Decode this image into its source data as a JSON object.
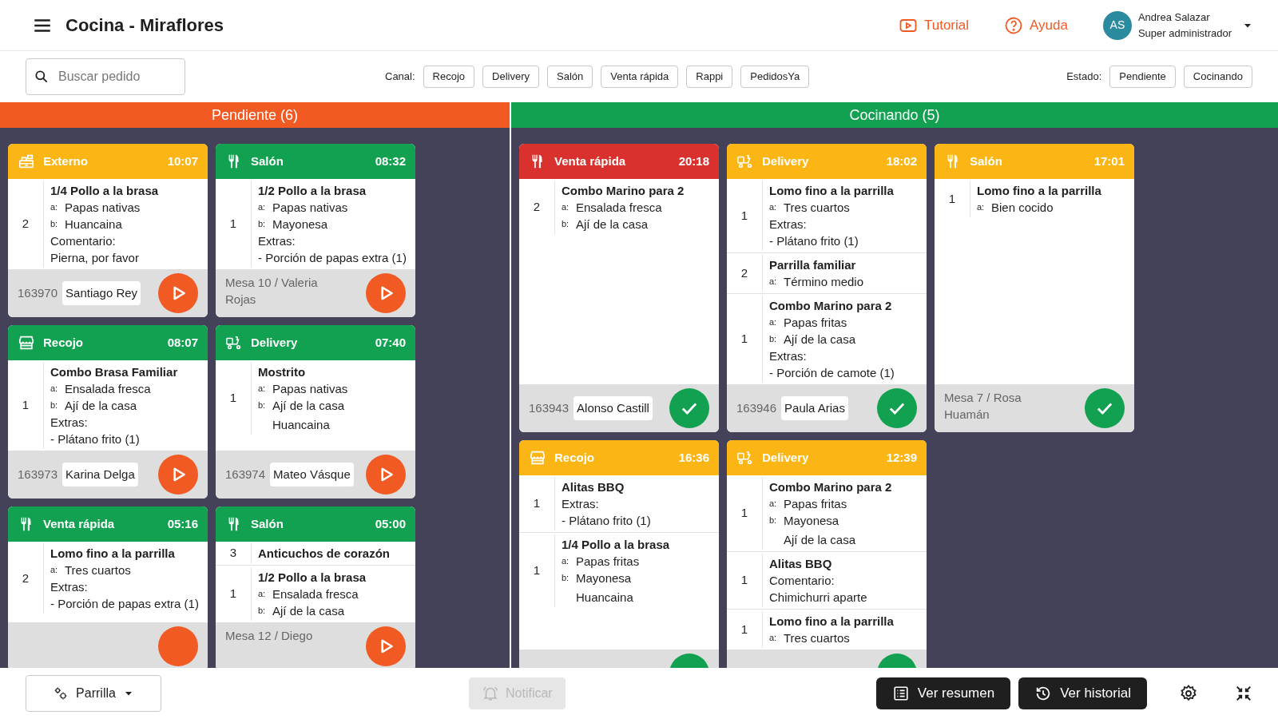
{
  "header": {
    "title": "Cocina - Miraflores",
    "links": [
      {
        "kind": "video",
        "label": "Tutorial"
      },
      {
        "kind": "help",
        "label": "Ayuda"
      }
    ],
    "user": {
      "initials": "AS",
      "name": "Andrea Salazar",
      "role": "Super administrador"
    }
  },
  "filters": {
    "search": {
      "placeholder": "Buscar pedido"
    },
    "channel": {
      "label": "Canal:",
      "options": [
        "Recojo",
        "Delivery",
        "Salón",
        "Venta rápida",
        "Rappi",
        "PedidosYa"
      ]
    },
    "state": {
      "label": "Estado:",
      "options": [
        "Pendiente",
        "Cocinando"
      ]
    }
  },
  "columns": [
    {
      "title": "Pendiente (6)",
      "color": "#f15a22",
      "kind": "pending",
      "cards": [
        {
          "kind": "register",
          "channel": "Externo",
          "time": "10:07",
          "color": "#fbb615",
          "items": [
            {
              "qty": "2",
              "name": "1/4 Pollo a la brasa",
              "lines": [
                {
                  "kind": "option",
                  "label": "a:",
                  "text": "Papas nativas"
                },
                {
                  "kind": "option",
                  "label": "b:",
                  "text": "Huancaina"
                },
                {
                  "kind": "note",
                  "text": "Comentario:"
                },
                {
                  "kind": "note",
                  "text": "Pierna, por favor"
                }
              ]
            }
          ],
          "footer": {
            "order": "163970",
            "customer": "Santiago Rey"
          }
        },
        {
          "kind": "cutlery",
          "channel": "Salón",
          "time": "08:32",
          "color": "#12a150",
          "items": [
            {
              "qty": "1",
              "name": "1/2 Pollo a la brasa",
              "lines": [
                {
                  "kind": "option",
                  "label": "a:",
                  "text": "Papas nativas"
                },
                {
                  "kind": "option",
                  "label": "b:",
                  "text": "Mayonesa"
                },
                {
                  "kind": "note",
                  "text": "Extras:"
                },
                {
                  "kind": "note",
                  "text": "- Porción de papas extra (1)"
                }
              ]
            }
          ],
          "footer": {
            "table": "Mesa 10 / Valeria Rojas"
          }
        },
        {
          "kind": "store",
          "channel": "Recojo",
          "time": "08:07",
          "color": "#12a150",
          "items": [
            {
              "qty": "1",
              "name": "Combo Brasa Familiar",
              "lines": [
                {
                  "kind": "option",
                  "label": "a:",
                  "text": "Ensalada fresca"
                },
                {
                  "kind": "option",
                  "label": "b:",
                  "text": "Ají de la casa"
                },
                {
                  "kind": "note",
                  "text": "Extras:"
                },
                {
                  "kind": "note",
                  "text": "- Plátano frito (1)"
                }
              ]
            }
          ],
          "footer": {
            "order": "163973",
            "customer": "Karina Delga"
          }
        },
        {
          "kind": "delivery",
          "channel": "Delivery",
          "time": "07:40",
          "color": "#12a150",
          "items": [
            {
              "qty": "1",
              "name": "Mostrito",
              "lines": [
                {
                  "kind": "option",
                  "label": "a:",
                  "text": "Papas nativas"
                },
                {
                  "kind": "option",
                  "label": "b:",
                  "text": "Ají de la casa"
                },
                {
                  "kind": "continued",
                  "text": "Huancaina"
                }
              ]
            }
          ],
          "footer": {
            "order": "163974",
            "customer": "Mateo Vásque"
          }
        },
        {
          "kind": "cutlery",
          "channel": "Venta rápida",
          "time": "05:16",
          "color": "#12a150",
          "items": [
            {
              "qty": "2",
              "name": "Lomo fino a la parrilla",
              "lines": [
                {
                  "kind": "option",
                  "label": "a:",
                  "text": "Tres cuartos"
                },
                {
                  "kind": "note",
                  "text": "Extras:"
                },
                {
                  "kind": "note",
                  "text": "- Porción de papas extra (1)"
                }
              ]
            }
          ]
        },
        {
          "kind": "cutlery",
          "channel": "Salón",
          "time": "05:00",
          "color": "#12a150",
          "items": [
            {
              "qty": "3",
              "name": "Anticuchos de corazón"
            },
            {
              "qty": "1",
              "name": "1/2 Pollo a la brasa",
              "lines": [
                {
                  "kind": "option",
                  "label": "a:",
                  "text": "Ensalada fresca"
                },
                {
                  "kind": "option",
                  "label": "b:",
                  "text": "Ají de la casa"
                }
              ]
            }
          ],
          "footer": {
            "table": "Mesa 12 / Diego"
          }
        }
      ]
    },
    {
      "title": "Cocinando (5)",
      "color": "#12a150",
      "kind": "cooking",
      "cards": [
        {
          "kind": "cutlery",
          "channel": "Venta rápida",
          "time": "20:18",
          "color": "#d9322e",
          "items": [
            {
              "qty": "2",
              "name": "Combo Marino para 2",
              "lines": [
                {
                  "kind": "option",
                  "label": "a:",
                  "text": "Ensalada fresca"
                },
                {
                  "kind": "option",
                  "label": "b:",
                  "text": "Ají de la casa"
                }
              ]
            }
          ],
          "footer": {
            "order": "163943",
            "customer": "Alonso Castill"
          }
        },
        {
          "kind": "delivery",
          "channel": "Delivery",
          "time": "18:02",
          "color": "#fbb615",
          "items": [
            {
              "qty": "1",
              "name": "Lomo fino a la parrilla",
              "lines": [
                {
                  "kind": "option",
                  "label": "a:",
                  "text": "Tres cuartos"
                },
                {
                  "kind": "note",
                  "text": "Extras:"
                },
                {
                  "kind": "note",
                  "text": "- Plátano frito (1)"
                }
              ]
            },
            {
              "qty": "2",
              "name": "Parrilla familiar",
              "lines": [
                {
                  "kind": "option",
                  "label": "a:",
                  "text": "Término medio"
                }
              ]
            },
            {
              "qty": "1",
              "name": "Combo Marino para 2",
              "lines": [
                {
                  "kind": "option",
                  "label": "a:",
                  "text": "Papas fritas"
                },
                {
                  "kind": "option",
                  "label": "b:",
                  "text": "Ají de la casa"
                },
                {
                  "kind": "note",
                  "text": "Extras:"
                },
                {
                  "kind": "note",
                  "text": "- Porción de camote (1)"
                }
              ]
            }
          ],
          "footer": {
            "order": "163946",
            "customer": "Paula Arias"
          }
        },
        {
          "kind": "cutlery",
          "channel": "Salón",
          "time": "17:01",
          "color": "#fbb615",
          "items": [
            {
              "qty": "1",
              "name": "Lomo fino a la parrilla",
              "lines": [
                {
                  "kind": "option",
                  "label": "a:",
                  "text": "Bien cocido"
                }
              ]
            }
          ],
          "footer": {
            "table": "Mesa 7 / Rosa Huamán"
          }
        },
        {
          "kind": "store",
          "channel": "Recojo",
          "time": "16:36",
          "color": "#fbb615",
          "items": [
            {
              "qty": "1",
              "name": "Alitas BBQ",
              "lines": [
                {
                  "kind": "note",
                  "text": "Extras:"
                },
                {
                  "kind": "note",
                  "text": "- Plátano frito (1)"
                }
              ]
            },
            {
              "qty": "1",
              "name": "1/4 Pollo a la brasa",
              "lines": [
                {
                  "kind": "option",
                  "label": "a:",
                  "text": "Papas fritas"
                },
                {
                  "kind": "option",
                  "label": "b:",
                  "text": "Mayonesa"
                },
                {
                  "kind": "continued",
                  "text": "Huancaina"
                }
              ]
            }
          ]
        },
        {
          "kind": "delivery",
          "channel": "Delivery",
          "time": "12:39",
          "color": "#fbb615",
          "items": [
            {
              "qty": "1",
              "name": "Combo Marino para 2",
              "lines": [
                {
                  "kind": "option",
                  "label": "a:",
                  "text": "Papas fritas"
                },
                {
                  "kind": "option",
                  "label": "b:",
                  "text": "Mayonesa"
                },
                {
                  "kind": "continued",
                  "text": "Ají de la casa"
                }
              ]
            },
            {
              "qty": "1",
              "name": "Alitas BBQ",
              "lines": [
                {
                  "kind": "note",
                  "text": "Comentario:"
                },
                {
                  "kind": "note",
                  "text": "Chimichurri aparte"
                }
              ]
            },
            {
              "qty": "1",
              "name": "Lomo fino a la parrilla",
              "lines": [
                {
                  "kind": "option",
                  "label": "a:",
                  "text": "Tres cuartos"
                }
              ]
            }
          ]
        }
      ]
    }
  ],
  "bottom_bar": {
    "station": "Parrilla",
    "notify": {
      "label": "Notificar",
      "disabled": true
    },
    "buttons": [
      {
        "kind": "summary",
        "label": "Ver resumen"
      },
      {
        "kind": "history",
        "label": "Ver historial"
      }
    ]
  }
}
